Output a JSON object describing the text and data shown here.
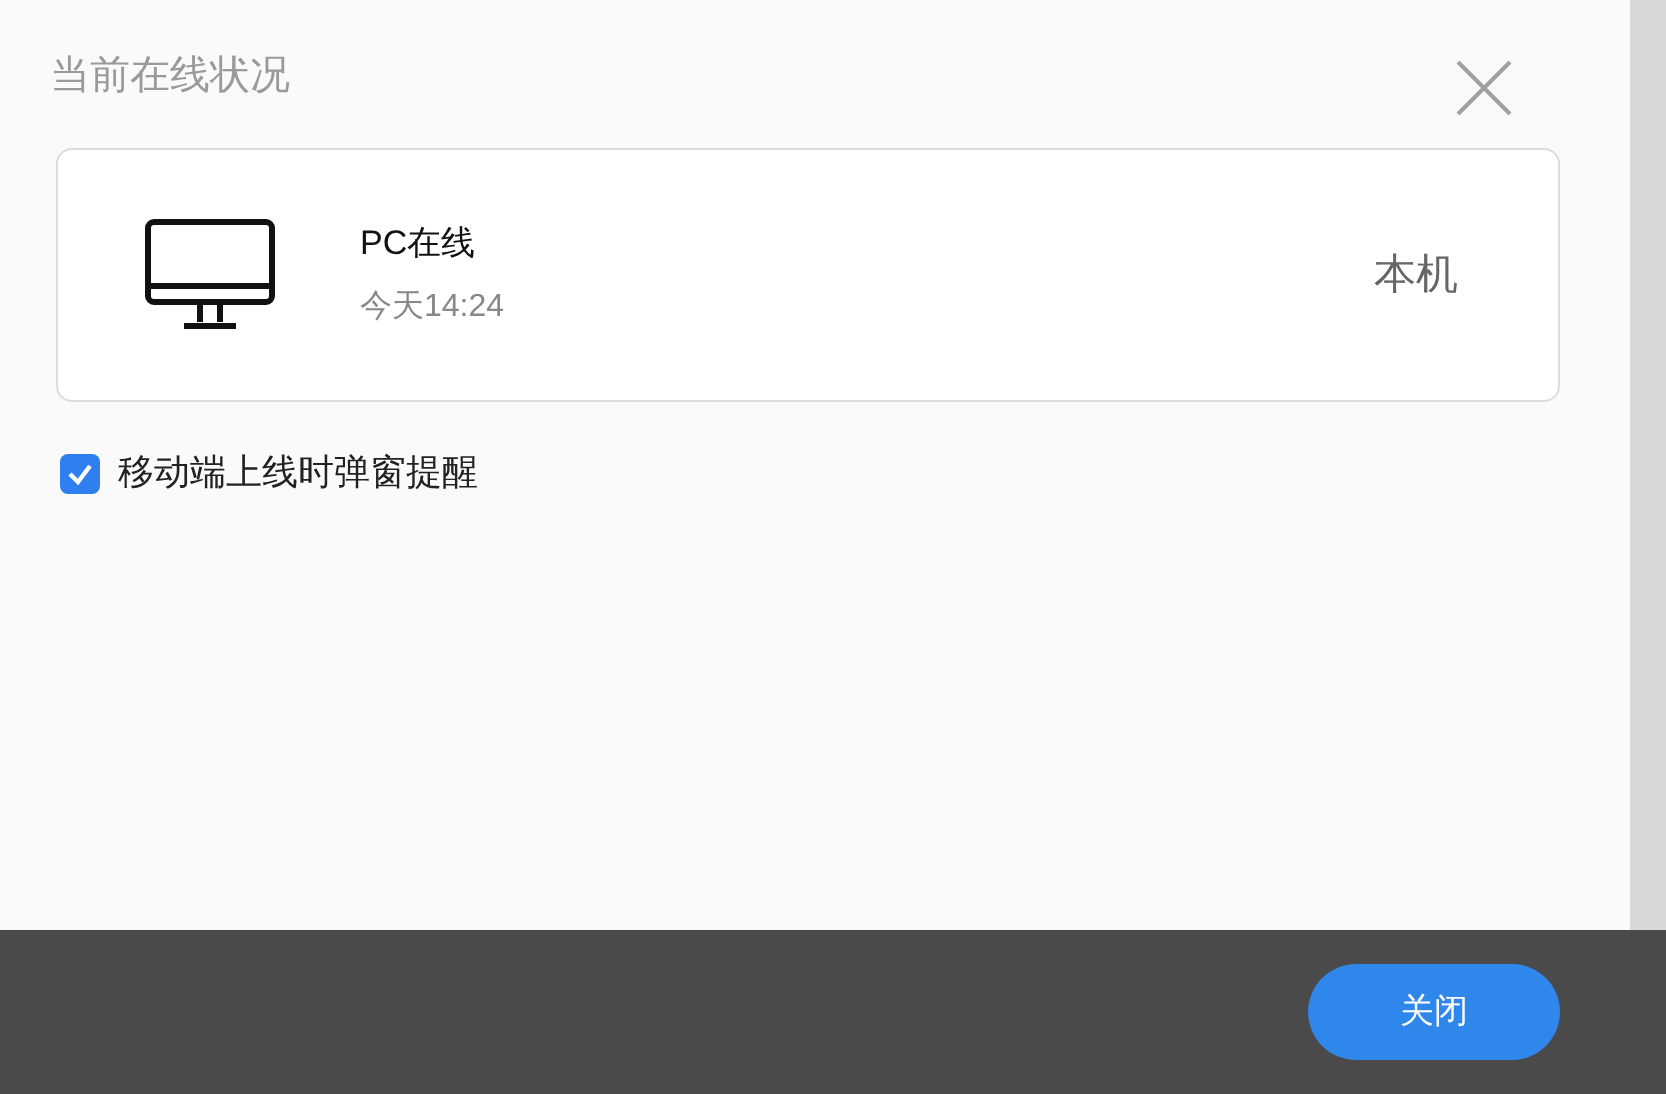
{
  "dialog": {
    "title": "当前在线状况"
  },
  "sessions": [
    {
      "kind": "pc",
      "name": "PC在线",
      "time": "今天14:24",
      "tag": "本机"
    }
  ],
  "popup_option": {
    "label": "移动端上线时弹窗提醒",
    "checked": true
  },
  "buttons": [
    {
      "label": "关闭"
    }
  ]
}
